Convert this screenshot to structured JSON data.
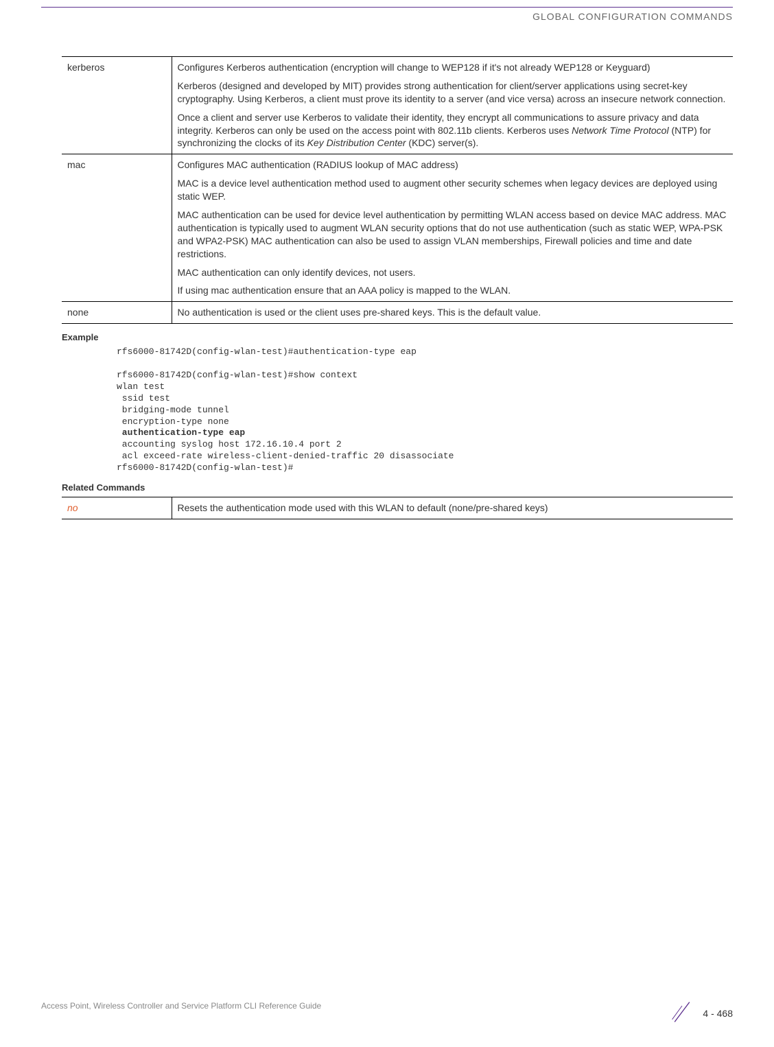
{
  "header": {
    "title": "GLOBAL CONFIGURATION COMMANDS"
  },
  "params_table": {
    "rows": [
      {
        "name": "kerberos",
        "desc_paragraphs": [
          "Configures Kerberos authentication (encryption will change to WEP128 if it's not already WEP128 or Keyguard)",
          "Kerberos (designed and developed by MIT) provides strong authentication for client/server applications using secret-key cryptography. Using Kerberos, a client must prove its identity to a server (and vice versa) across an insecure network connection.",
          "Once a client and server use Kerberos to validate their identity, they encrypt all communications to assure privacy and data integrity. Kerberos can only be used on the access point with 802.11b clients. Kerberos uses <i>Network Time Protocol</i> (NTP) for synchronizing the clocks of its <i>Key Distribution Center</i> (KDC) server(s)."
        ]
      },
      {
        "name": "mac",
        "desc_paragraphs": [
          "Configures MAC authentication (RADIUS lookup of MAC address)",
          "MAC is a device level authentication method used to augment other security schemes when legacy devices are deployed using static WEP.",
          "MAC authentication can be used for device level authentication by permitting WLAN access based on device MAC address. MAC authentication is typically used to augment WLAN security options that do not use authentication (such as static WEP, WPA-PSK and WPA2-PSK) MAC authentication can also be used to assign VLAN memberships, Firewall policies and time and date restrictions.",
          "MAC authentication can only identify devices, not users.",
          "If using mac authentication ensure that an AAA policy is mapped to the WLAN."
        ]
      },
      {
        "name": "none",
        "desc_paragraphs": [
          "No authentication is used or the client uses pre-shared keys. This is the default value."
        ]
      }
    ]
  },
  "example": {
    "label": "Example",
    "lines": [
      "rfs6000-81742D(config-wlan-test)#authentication-type eap",
      "",
      "rfs6000-81742D(config-wlan-test)#show context",
      "wlan test",
      " ssid test",
      " bridging-mode tunnel",
      " encryption-type none",
      {
        "bold": true,
        "text": " authentication-type eap"
      },
      " accounting syslog host 172.16.10.4 port 2",
      " acl exceed-rate wireless-client-denied-traffic 20 disassociate",
      "rfs6000-81742D(config-wlan-test)#"
    ]
  },
  "related": {
    "label": "Related Commands",
    "rows": [
      {
        "name": "no",
        "desc": "Resets the authentication mode used with this WLAN to default (none/pre-shared keys)"
      }
    ]
  },
  "footer": {
    "text": "Access Point, Wireless Controller and Service Platform CLI Reference Guide",
    "page": "4 - 468"
  }
}
